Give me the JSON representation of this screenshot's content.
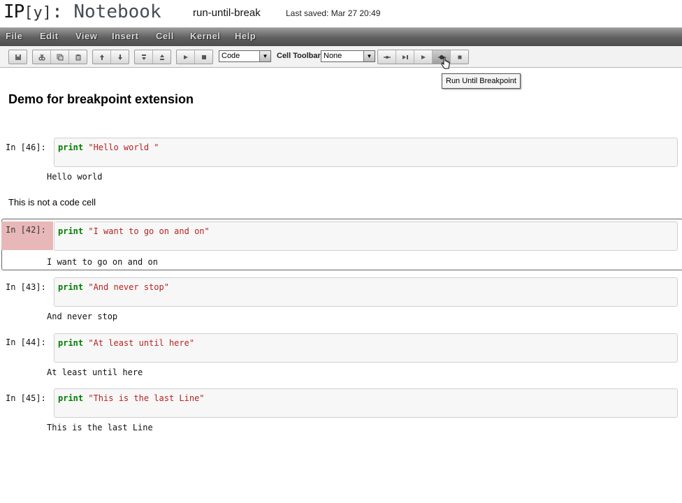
{
  "header": {
    "logo_ip": "IP",
    "logo_y": "[y]",
    "logo_colon": ":",
    "logo_notebook": "Notebook",
    "notebook_name": "run-until-break",
    "save_status": "Last saved: Mar 27 20:49"
  },
  "menubar": {
    "items": [
      "File",
      "Edit",
      "View",
      "Insert",
      "Cell",
      "Kernel",
      "Help"
    ]
  },
  "toolbar": {
    "cell_type_select": "Code",
    "cell_toolbar_label": "Cell Toolbar:",
    "cell_toolbar_select": "None",
    "icons": {
      "save": "save-icon",
      "cut": "cut-icon",
      "copy": "copy-icon",
      "paste": "paste-icon",
      "move_up": "arrow-up-icon",
      "move_down": "arrow-down-icon",
      "insert_below": "insert-below-icon",
      "insert_above": "insert-above-icon",
      "run": "play-icon",
      "stop": "stop-icon",
      "breakpoint_toggle": "breakpoint-toggle-icon",
      "step": "step-icon",
      "continue": "continue-icon",
      "run_until_breakpoint": "run-until-breakpoint-icon",
      "clear": "clear-icon"
    }
  },
  "tooltip": "Run Until Breakpoint",
  "heading": "Demo for breakpoint extension",
  "markdown_cell": "This is not a code cell",
  "cells": [
    {
      "prompt": "In [46]:",
      "keyword": "print",
      "string": " \"Hello world \"",
      "output": "Hello world"
    },
    {
      "prompt": "In [42]:",
      "keyword": "print",
      "string": " \"I want to go on and on\"",
      "output": "I want to go on and on"
    },
    {
      "prompt": "In [43]:",
      "keyword": "print",
      "string": " \"And never stop\"",
      "output": "And never stop"
    },
    {
      "prompt": "In [44]:",
      "keyword": "print",
      "string": " \"At least until here\"",
      "output": "At least until here"
    },
    {
      "prompt": "In [45]:",
      "keyword": "print",
      "string": " \"This is the last Line\"",
      "output": "This is the last Line"
    }
  ],
  "colors": {
    "keyword": "#008000",
    "string": "#ba2121",
    "breakpoint_prompt": "#e8b8b8",
    "menubar": "#5f5f5f"
  }
}
